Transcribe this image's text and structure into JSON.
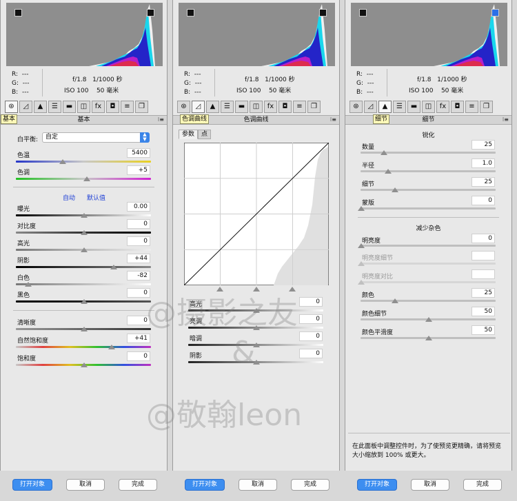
{
  "readout": {
    "r": "R:",
    "g": "G:",
    "b": "B:",
    "dash": "---",
    "aperture": "f/1.8",
    "shutter": "1/1000 秒",
    "iso": "ISO 100",
    "focal": "50 毫米"
  },
  "tools": [
    "⊛",
    "◿",
    "▲",
    "☰",
    "▬",
    "◫",
    "(|)",
    "fx",
    "◘",
    "≡",
    "❐"
  ],
  "basic": {
    "header": "基本",
    "tooltip": "基本",
    "wb_label": "白平衡:",
    "wb_value": "自定",
    "temp_label": "色温",
    "temp_value": "5400",
    "tint_label": "色调",
    "tint_value": "+5",
    "auto": "自动",
    "default": "默认值",
    "exposure_label": "曝光",
    "exposure_value": "0.00",
    "contrast_label": "对比度",
    "contrast_value": "0",
    "highlights_label": "高光",
    "highlights_value": "0",
    "shadows_label": "阴影",
    "shadows_value": "+44",
    "whites_label": "白色",
    "whites_value": "-82",
    "blacks_label": "黑色",
    "blacks_value": "0",
    "clarity_label": "清晰度",
    "clarity_value": "0",
    "vibrance_label": "自然饱和度",
    "vibrance_value": "+41",
    "saturation_label": "饱和度",
    "saturation_value": "0"
  },
  "curve": {
    "header": "色调曲线",
    "tooltip": "色调曲线",
    "tab_param": "参数",
    "tab_point": "点",
    "highlights_label": "高光",
    "highlights_value": "0",
    "lights_label": "亮调",
    "lights_value": "0",
    "darks_label": "暗调",
    "darks_value": "0",
    "shadows_label": "阴影",
    "shadows_value": "0"
  },
  "detail": {
    "header": "细节",
    "tooltip": "细节",
    "sharpen_title": "锐化",
    "amount_label": "数量",
    "amount_value": "25",
    "radius_label": "半径",
    "radius_value": "1.0",
    "detail_label": "细节",
    "detail_value": "25",
    "masking_label": "蒙版",
    "masking_value": "0",
    "nr_title": "减少杂色",
    "lum_label": "明亮度",
    "lum_value": "0",
    "lumdetail_label": "明亮度细节",
    "lumcontrast_label": "明亮度对比",
    "color_label": "颜色",
    "color_value": "25",
    "colordetail_label": "颜色细节",
    "colordetail_value": "50",
    "colorsmooth_label": "颜色平滑度",
    "colorsmooth_value": "50",
    "note": "在此面板中调整控件时，为了使预览更精确，请将预览大小缩放到 100% 或更大。"
  },
  "buttons": {
    "open": "打开对象",
    "cancel": "取消",
    "done": "完成"
  },
  "watermark": {
    "line1": "@摄影之友",
    "line2": "&",
    "line3": "@敬翰leon"
  }
}
